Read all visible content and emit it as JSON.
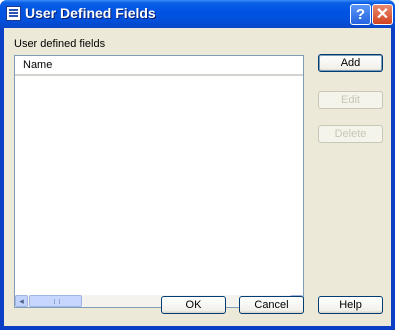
{
  "window": {
    "title": "User Defined Fields",
    "title_icon": "dialog-list-icon",
    "help_glyph": "?",
    "close_glyph": "✕"
  },
  "group": {
    "label": "User defined fields"
  },
  "list": {
    "columns": [
      "Name"
    ],
    "rows": [],
    "scroll_left_glyph": "◂",
    "scroll_right_glyph": "▸"
  },
  "side_buttons": {
    "add": "Add",
    "edit": "Edit",
    "delete": "Delete"
  },
  "footer_buttons": {
    "ok": "OK",
    "cancel": "Cancel",
    "help": "Help"
  }
}
